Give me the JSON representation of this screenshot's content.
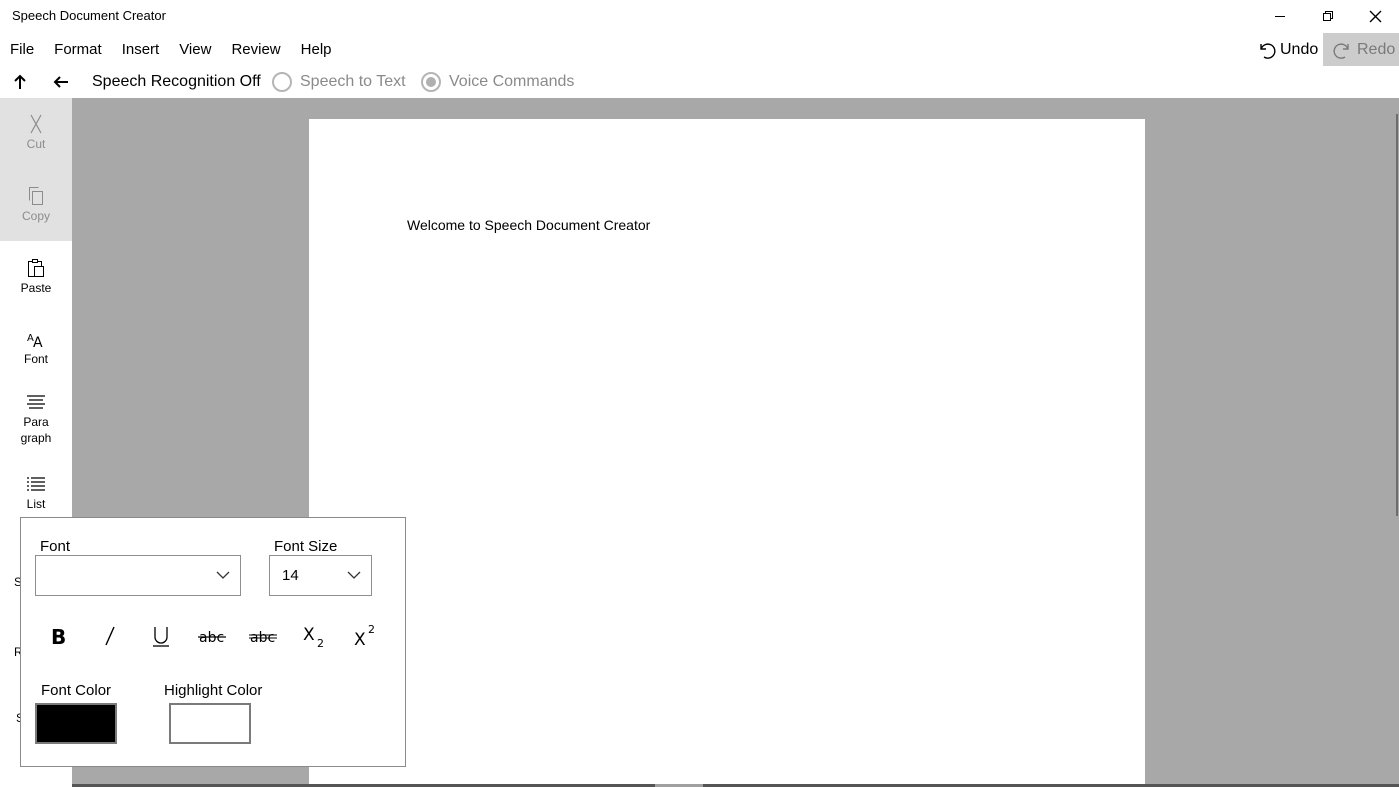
{
  "window": {
    "title": "Speech Document Creator",
    "controls": {
      "minimize_icon": "minimize-icon",
      "restore_icon": "restore-icon",
      "close_icon": "close-icon"
    }
  },
  "menu": {
    "items": [
      "File",
      "Format",
      "Insert",
      "View",
      "Review",
      "Help"
    ],
    "undo_label": "Undo",
    "redo_label": "Redo"
  },
  "speech_toolbar": {
    "status": "Speech Recognition Off",
    "options": [
      {
        "label": "Speech to Text",
        "checked": false
      },
      {
        "label": "Voice Commands",
        "checked": true
      }
    ]
  },
  "rail": {
    "items": [
      {
        "label": "Cut",
        "icon": "scissors-icon",
        "enabled": false
      },
      {
        "label": "Copy",
        "icon": "copy-icon",
        "enabled": false
      },
      {
        "label": "Paste",
        "icon": "paste-icon",
        "enabled": true
      },
      {
        "label": "Font",
        "icon": "font-icon",
        "enabled": true
      },
      {
        "label": "Para\ngraph",
        "icon": "paragraph-icon",
        "enabled": true
      },
      {
        "label": "List",
        "icon": "list-icon",
        "enabled": true
      }
    ],
    "partial_letters": [
      "S",
      "R",
      "S"
    ]
  },
  "document": {
    "text": "Welcome to Speech Document Creator"
  },
  "font_flyout": {
    "font_label": "Font",
    "font_value": "",
    "size_label": "Font Size",
    "size_value": "14",
    "format_buttons": [
      "bold-icon",
      "italic-icon",
      "underline-icon",
      "strikethrough-icon",
      "double-strikethrough-icon",
      "subscript-icon",
      "superscript-icon"
    ],
    "font_color_label": "Font Color",
    "font_color": "#000000",
    "highlight_color_label": "Highlight Color",
    "highlight_color": "#ffffff"
  },
  "colors": {
    "workspace": "#a8a8a8",
    "rail_disabled": "#e1e1e1",
    "redo_disabled": "#cccccc"
  }
}
